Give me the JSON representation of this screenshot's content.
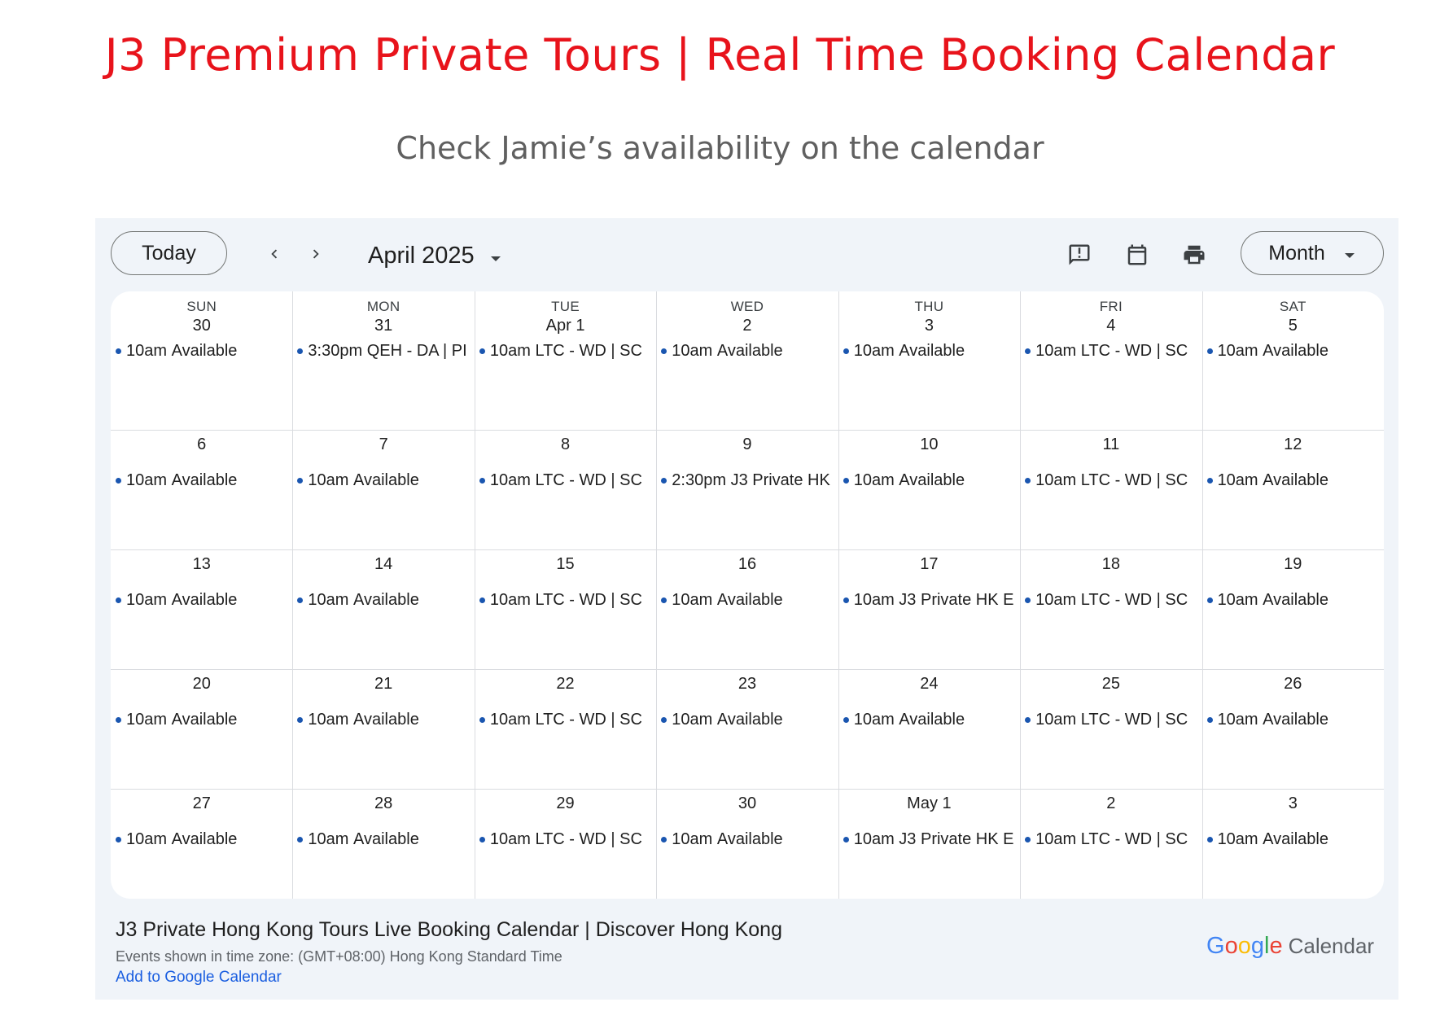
{
  "page": {
    "title": "J3 Premium Private Tours | Real Time Booking Calendar",
    "subtitle": "Check Jamie’s availability on the calendar"
  },
  "toolbar": {
    "today_label": "Today",
    "month_label": "April 2025",
    "view_label": "Month",
    "icons": [
      "chevron-left-icon",
      "chevron-right-icon",
      "feedback-icon",
      "calendar-icon",
      "print-icon",
      "caret-down-icon"
    ]
  },
  "calendar": {
    "weekdays": [
      "SUN",
      "MON",
      "TUE",
      "WED",
      "THU",
      "FRI",
      "SAT"
    ],
    "weeks": [
      [
        {
          "day": "30",
          "events": [
            {
              "time": "10am",
              "title": "Available"
            }
          ]
        },
        {
          "day": "31",
          "events": [
            {
              "time": "3:30pm",
              "title": "QEH - DA | PI"
            }
          ]
        },
        {
          "day": "Apr 1",
          "events": [
            {
              "time": "10am",
              "title": "LTC - WD | SC"
            }
          ]
        },
        {
          "day": "2",
          "events": [
            {
              "time": "10am",
              "title": "Available"
            }
          ]
        },
        {
          "day": "3",
          "events": [
            {
              "time": "10am",
              "title": "Available"
            }
          ]
        },
        {
          "day": "4",
          "events": [
            {
              "time": "10am",
              "title": "LTC - WD | SC"
            }
          ]
        },
        {
          "day": "5",
          "events": [
            {
              "time": "10am",
              "title": "Available"
            }
          ]
        }
      ],
      [
        {
          "day": "6",
          "events": [
            {
              "time": "10am",
              "title": "Available"
            }
          ]
        },
        {
          "day": "7",
          "events": [
            {
              "time": "10am",
              "title": "Available"
            }
          ]
        },
        {
          "day": "8",
          "events": [
            {
              "time": "10am",
              "title": "LTC - WD | SC"
            }
          ]
        },
        {
          "day": "9",
          "events": [
            {
              "time": "2:30pm",
              "title": "J3 Private HK"
            }
          ]
        },
        {
          "day": "10",
          "events": [
            {
              "time": "10am",
              "title": "Available"
            }
          ]
        },
        {
          "day": "11",
          "events": [
            {
              "time": "10am",
              "title": "LTC - WD | SC"
            }
          ]
        },
        {
          "day": "12",
          "events": [
            {
              "time": "10am",
              "title": "Available"
            }
          ]
        }
      ],
      [
        {
          "day": "13",
          "events": [
            {
              "time": "10am",
              "title": "Available"
            }
          ]
        },
        {
          "day": "14",
          "events": [
            {
              "time": "10am",
              "title": "Available"
            }
          ]
        },
        {
          "day": "15",
          "events": [
            {
              "time": "10am",
              "title": "LTC - WD | SC"
            }
          ]
        },
        {
          "day": "16",
          "events": [
            {
              "time": "10am",
              "title": "Available"
            }
          ]
        },
        {
          "day": "17",
          "events": [
            {
              "time": "10am",
              "title": "J3 Private HK E"
            }
          ]
        },
        {
          "day": "18",
          "events": [
            {
              "time": "10am",
              "title": "LTC - WD | SC"
            }
          ]
        },
        {
          "day": "19",
          "events": [
            {
              "time": "10am",
              "title": "Available"
            }
          ]
        }
      ],
      [
        {
          "day": "20",
          "events": [
            {
              "time": "10am",
              "title": "Available"
            }
          ]
        },
        {
          "day": "21",
          "events": [
            {
              "time": "10am",
              "title": "Available"
            }
          ]
        },
        {
          "day": "22",
          "events": [
            {
              "time": "10am",
              "title": "LTC - WD | SC"
            }
          ]
        },
        {
          "day": "23",
          "events": [
            {
              "time": "10am",
              "title": "Available"
            }
          ]
        },
        {
          "day": "24",
          "events": [
            {
              "time": "10am",
              "title": "Available"
            }
          ]
        },
        {
          "day": "25",
          "events": [
            {
              "time": "10am",
              "title": "LTC - WD | SC"
            }
          ]
        },
        {
          "day": "26",
          "events": [
            {
              "time": "10am",
              "title": "Available"
            }
          ]
        }
      ],
      [
        {
          "day": "27",
          "events": [
            {
              "time": "10am",
              "title": "Available"
            }
          ]
        },
        {
          "day": "28",
          "events": [
            {
              "time": "10am",
              "title": "Available"
            }
          ]
        },
        {
          "day": "29",
          "events": [
            {
              "time": "10am",
              "title": "LTC - WD | SC"
            }
          ]
        },
        {
          "day": "30",
          "events": [
            {
              "time": "10am",
              "title": "Available"
            }
          ]
        },
        {
          "day": "May 1",
          "events": [
            {
              "time": "10am",
              "title": "J3 Private HK E"
            }
          ]
        },
        {
          "day": "2",
          "events": [
            {
              "time": "10am",
              "title": "LTC - WD | SC"
            }
          ]
        },
        {
          "day": "3",
          "events": [
            {
              "time": "10am",
              "title": "Available"
            }
          ]
        }
      ]
    ]
  },
  "footer": {
    "calendar_title": "J3 Private Hong Kong Tours Live Booking Calendar | Discover Hong Kong",
    "timezone_text": "Events shown in time zone: (GMT+08:00) Hong Kong Standard Time",
    "add_link": "Add to Google Calendar",
    "brand": {
      "google_letters": [
        "G",
        "o",
        "o",
        "g",
        "l",
        "e"
      ],
      "google_colors": [
        "#4285F4",
        "#EA4335",
        "#FBBC05",
        "#4285F4",
        "#34A853",
        "#EA4335"
      ],
      "product": "Calendar"
    }
  },
  "colors": {
    "title": "#e8131b",
    "subtitle": "#606060",
    "frame_bg": "#f0f4f9",
    "event_dot": "#1a56b0",
    "link": "#1a5ee0"
  }
}
